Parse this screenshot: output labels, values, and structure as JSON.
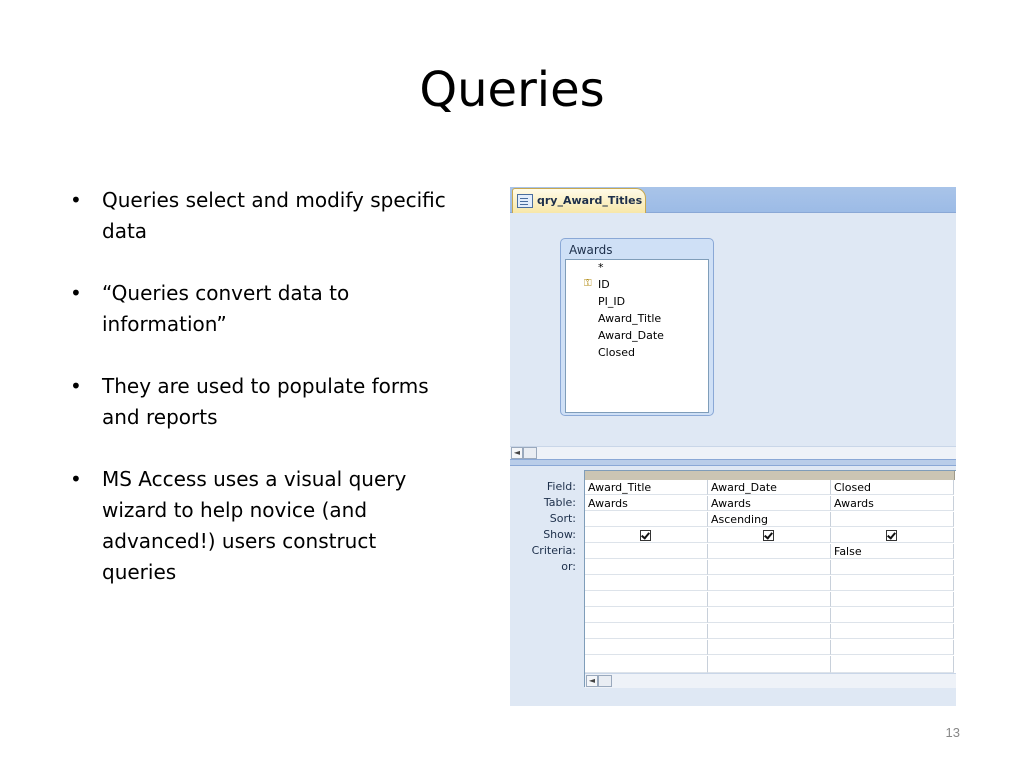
{
  "slide": {
    "title": "Queries",
    "bullets": [
      "Queries select and modify specific data",
      "“Queries convert data to information”",
      "They are used to populate forms and reports",
      "MS Access uses a visual query wizard to help novice (and advanced!) users construct queries"
    ],
    "bullet_glyph": "•",
    "page_number": "13"
  },
  "access": {
    "tab_label": "qry_Award_Titles",
    "table_box": {
      "title": "Awards",
      "fields": [
        "*",
        "ID",
        "PI_ID",
        "Award_Title",
        "Award_Date",
        "Closed"
      ],
      "primary_key": "ID"
    },
    "grid": {
      "row_labels": [
        "Field:",
        "Table:",
        "Sort:",
        "Show:",
        "Criteria:",
        "or:"
      ],
      "columns": [
        {
          "field": "Award_Title",
          "table": "Awards",
          "sort": "",
          "show": true,
          "criteria": ""
        },
        {
          "field": "Award_Date",
          "table": "Awards",
          "sort": "Ascending",
          "show": true,
          "criteria": ""
        },
        {
          "field": "Closed",
          "table": "Awards",
          "sort": "",
          "show": true,
          "criteria": "False"
        }
      ]
    },
    "scroll_left_glyph": "◄"
  },
  "colors": {
    "tab_bar": "#9cbbe6",
    "active_tab": "#f7e7a8",
    "design_background": "#dfe8f4"
  }
}
